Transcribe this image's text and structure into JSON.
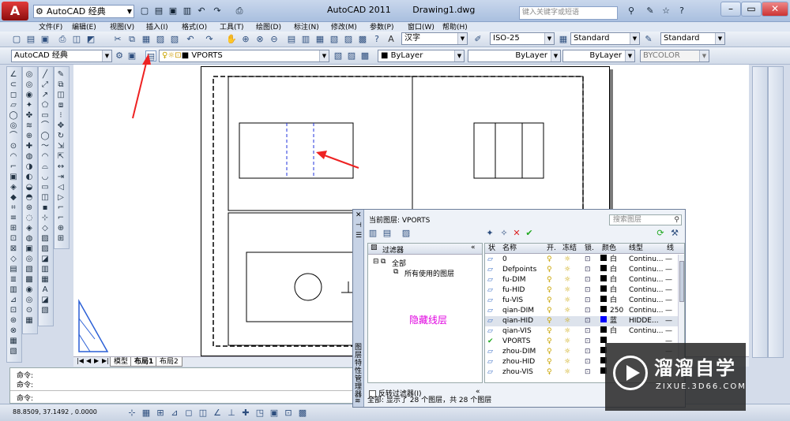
{
  "app": {
    "logo_letter": "A",
    "workspace": "AutoCAD 经典",
    "title": "AutoCAD 2011",
    "document": "Drawing1.dwg",
    "help_placeholder": "键入关键字或短语"
  },
  "menus": [
    "文件(F)",
    "编辑(E)",
    "视图(V)",
    "插入(I)",
    "格式(O)",
    "工具(T)",
    "绘图(D)",
    "标注(N)",
    "修改(M)",
    "参数(P)",
    "窗口(W)",
    "帮助(H)"
  ],
  "toolbar1": {
    "text_style": "汉字",
    "dim_style": "ISO-25",
    "table_style": "Standard",
    "multileader_style": "Standard"
  },
  "toolbar2": {
    "workspace_combo": "AutoCAD 经典",
    "layer_combo": "VPORTS",
    "color_combo": "ByLayer",
    "linetype_combo": "ByLayer",
    "lineweight_combo": "ByLayer",
    "plotstyle_combo": "BYCOLOR"
  },
  "tabs": {
    "model": "模型",
    "layout1": "布局1",
    "layout2": "布局2"
  },
  "command": {
    "line1": "命令:",
    "line2": "命令:",
    "line3": "命令:"
  },
  "status": {
    "coords": "88.8509,  37.1492 ,  0.0000"
  },
  "layer_palette": {
    "current_layer": "当前图层: VPORTS",
    "search_placeholder": "搜索图层",
    "filters_title": "过滤器",
    "filter_all": "全部",
    "filter_used": "所有使用的图层",
    "invert_filter": "反转过滤器(I)",
    "columns": {
      "status": "状",
      "name": "名称",
      "on": "开.",
      "freeze": "冻结",
      "lock": "锁.",
      "color": "颜色",
      "linetype": "线型",
      "lineweight": "线"
    },
    "rows": [
      {
        "name": "0",
        "color_name": "白",
        "color_hex": "#000000",
        "linetype": "Continu..."
      },
      {
        "name": "Defpoints",
        "color_name": "白",
        "color_hex": "#000000",
        "linetype": "Continu..."
      },
      {
        "name": "fu-DIM",
        "color_name": "白",
        "color_hex": "#000000",
        "linetype": "Continu..."
      },
      {
        "name": "fu-HID",
        "color_name": "白",
        "color_hex": "#000000",
        "linetype": "Continu..."
      },
      {
        "name": "fu-VIS",
        "color_name": "白",
        "color_hex": "#000000",
        "linetype": "Continu..."
      },
      {
        "name": "qian-DIM",
        "color_name": "250",
        "color_hex": "#000000",
        "linetype": "Continu..."
      },
      {
        "name": "qian-HID",
        "color_name": "蓝",
        "color_hex": "#0000ff",
        "linetype": "HIDDE..."
      },
      {
        "name": "qian-VIS",
        "color_name": "白",
        "color_hex": "#000000",
        "linetype": "Continu..."
      },
      {
        "name": "VPORTS",
        "color_name": "",
        "color_hex": "#000000",
        "linetype": ""
      },
      {
        "name": "zhou-DIM",
        "color_name": "",
        "color_hex": "#000000",
        "linetype": ""
      },
      {
        "name": "zhou-HID",
        "color_name": "",
        "color_hex": "#000000",
        "linetype": ""
      },
      {
        "name": "zhou-VIS",
        "color_name": "",
        "color_hex": "#000000",
        "linetype": ""
      }
    ],
    "status_text": "全部: 显示了 28 个图层，共 28 个图层",
    "side_title": "图层特性管理器"
  },
  "annotation": {
    "hidden_layer": "隐藏线层",
    "color": "#e000e0"
  },
  "watermark": {
    "brand": "溜溜自学",
    "url": "ZIXUE.3D66.COM"
  }
}
